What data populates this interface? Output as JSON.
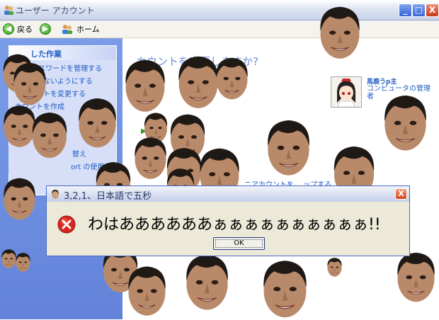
{
  "window": {
    "title": "ユーザー アカウント",
    "controls": {
      "minimize": "_",
      "maximize": "□",
      "close": "X"
    }
  },
  "toolbar": {
    "back_label": "戻る",
    "home_label": "ホーム"
  },
  "taskpane": {
    "header": "した作業",
    "items": [
      "ーク パスワードを管理する",
      "ドを忘れないようにする",
      "アカウントを変更する",
      "カウントを作成"
    ],
    "lower_items": [
      "替え",
      "ort の使用"
    ]
  },
  "main": {
    "heading": "カウントを変更しますか?",
    "link_fragment": "ニアカウントを… ップする",
    "user": {
      "name": "馬鹿うp主",
      "role": "コンピュータの管理者"
    }
  },
  "dialog": {
    "title": "3,2,1、日本語で五秒",
    "message": "わはああああああぁぁぁぁぁぁぁぁぁぁ!!",
    "ok_label": "OK",
    "close_label": "X"
  },
  "colors": {
    "xp_blue": "#215dc6",
    "taskpane_bg": "#7b9de8",
    "dialog_bg": "#ece9d8",
    "error_red": "#d8261e"
  }
}
